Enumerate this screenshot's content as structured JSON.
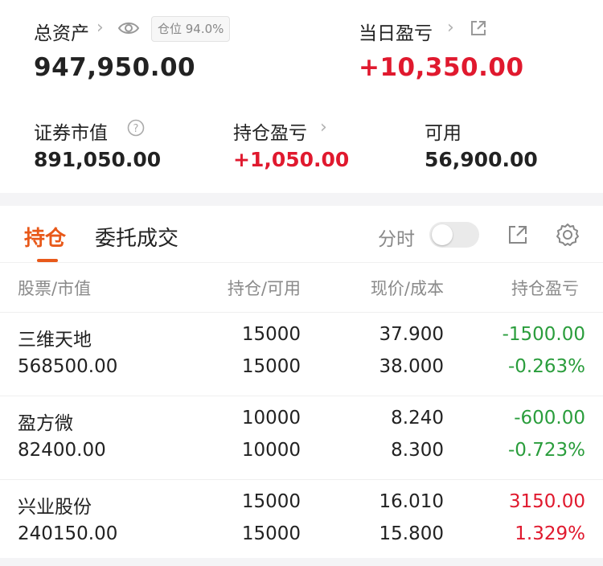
{
  "summary": {
    "total_assets_label": "总资产",
    "position_badge": "仓位 94.0%",
    "total_assets_value": "947,950.00",
    "daily_pnl_label": "当日盈亏",
    "daily_pnl_value": "+10,350.00",
    "market_value_label": "证券市值",
    "market_value_value": "891,050.00",
    "position_pnl_label": "持仓盈亏",
    "position_pnl_value": "+1,050.00",
    "available_label": "可用",
    "available_value": "56,900.00"
  },
  "tabs": [
    {
      "label": "持仓",
      "active": true
    },
    {
      "label": "委托成交",
      "active": false
    }
  ],
  "toolbar": {
    "intraday_label": "分时",
    "intraday_toggle_on": false
  },
  "table": {
    "headers": [
      "股票/市值",
      "持仓/可用",
      "现价/成本",
      "持仓盈亏"
    ],
    "rows": [
      {
        "name": "三维天地",
        "market_value": "568500.00",
        "holding": "15000",
        "available": "15000",
        "price": "37.900",
        "cost": "38.000",
        "pnl": "-1500.00",
        "pnl_pct": "-0.263%",
        "trend": "down"
      },
      {
        "name": "盈方微",
        "market_value": "82400.00",
        "holding": "10000",
        "available": "10000",
        "price": "8.240",
        "cost": "8.300",
        "pnl": "-600.00",
        "pnl_pct": "-0.723%",
        "trend": "down"
      },
      {
        "name": "兴业股份",
        "market_value": "240150.00",
        "holding": "15000",
        "available": "15000",
        "price": "16.010",
        "cost": "15.800",
        "pnl": "3150.00",
        "pnl_pct": "1.329%",
        "trend": "up"
      }
    ]
  },
  "colors": {
    "accent": "#e8591a",
    "gain": "#e0192e",
    "loss": "#2a9d3c"
  },
  "icons": [
    "chevron-right-icon",
    "eye-icon",
    "external-link-icon",
    "help-circle-icon",
    "share-icon",
    "gear-icon"
  ]
}
